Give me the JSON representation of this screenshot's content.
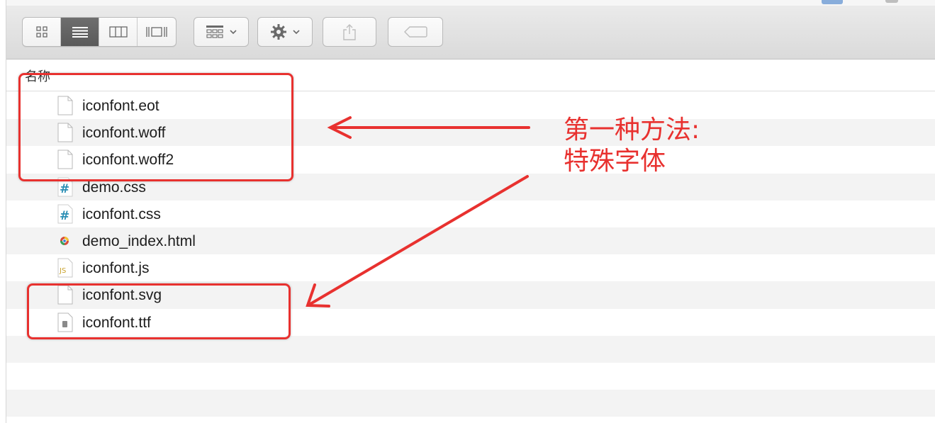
{
  "toolbar": {
    "view_modes": [
      {
        "name": "icon-view",
        "active": false
      },
      {
        "name": "list-view",
        "active": true
      },
      {
        "name": "column-view",
        "active": false
      },
      {
        "name": "coverflow-view",
        "active": false
      }
    ],
    "arrange_icon": "grid-arrange-icon",
    "action_icon": "gear-icon",
    "share_icon": "share-icon",
    "tag_icon": "tag-icon"
  },
  "list_header": {
    "name_label": "名称"
  },
  "files": [
    {
      "name": "iconfont.eot",
      "icon": "blank-file-icon"
    },
    {
      "name": "iconfont.woff",
      "icon": "blank-file-icon"
    },
    {
      "name": "iconfont.woff2",
      "icon": "blank-file-icon"
    },
    {
      "name": "demo.css",
      "icon": "css-file-icon"
    },
    {
      "name": "iconfont.css",
      "icon": "css-file-icon"
    },
    {
      "name": "demo_index.html",
      "icon": "chrome-html-icon"
    },
    {
      "name": "iconfont.js",
      "icon": "js-file-icon"
    },
    {
      "name": "iconfont.svg",
      "icon": "blank-file-icon"
    },
    {
      "name": "iconfont.ttf",
      "icon": "font-file-icon"
    }
  ],
  "annotation": {
    "line1": "第一种方法:",
    "line2": "特殊字体",
    "color": "#e8312f"
  }
}
